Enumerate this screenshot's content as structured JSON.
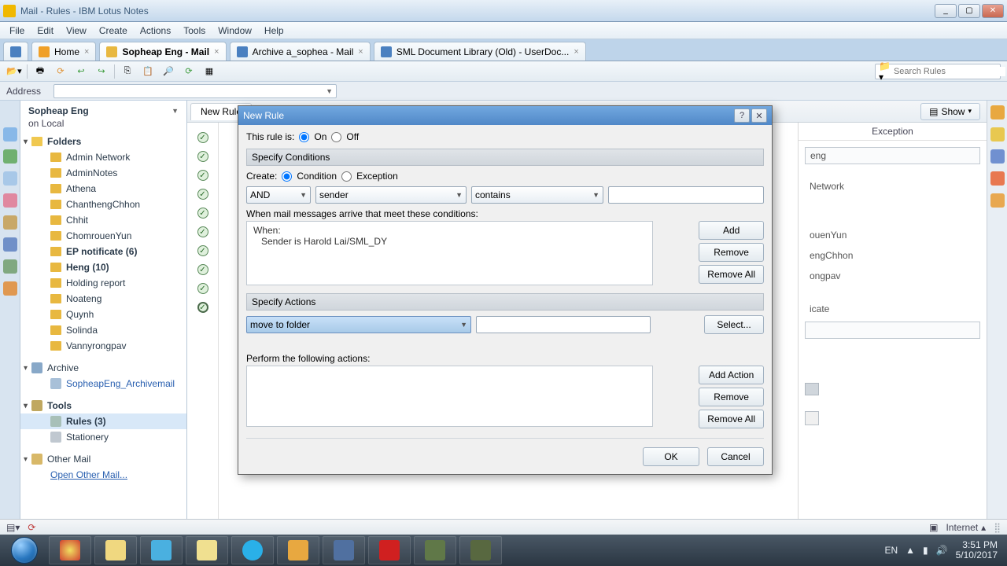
{
  "window": {
    "title": "Mail - Rules - IBM Lotus Notes"
  },
  "menu": {
    "file": "File",
    "edit": "Edit",
    "view": "View",
    "create": "Create",
    "actions": "Actions",
    "tools": "Tools",
    "window": "Window",
    "help": "Help"
  },
  "tabs": [
    {
      "label": "Home",
      "closable": true
    },
    {
      "label": "Sopheap Eng - Mail",
      "closable": true,
      "active": true
    },
    {
      "label": "Archive a_sophea - Mail",
      "closable": true
    },
    {
      "label": "SML Document Library (Old) - UserDoc...",
      "closable": true
    }
  ],
  "toolbar": {
    "search_placeholder": "Search Rules"
  },
  "addressbar": {
    "label": "Address"
  },
  "sidebar": {
    "account": "Sopheap Eng",
    "location": "on Local",
    "folders_label": "Folders",
    "folders": [
      "Admin Network",
      "AdminNotes",
      "Athena",
      "ChanthengChhon",
      "Chhit",
      "ChomrouenYun",
      "EP notificate (6)",
      "Heng (10)",
      "Holding report",
      "Noateng",
      "Quynh",
      "Solinda",
      "Vannyrongpav"
    ],
    "archive_label": "Archive",
    "archive_items": [
      "SopheapEng_Archivemail"
    ],
    "tools_label": "Tools",
    "tools_items": [
      "Rules (3)",
      "Stationery"
    ],
    "othermail_label": "Other Mail",
    "othermail_link": "Open Other Mail..."
  },
  "main": {
    "tab": "New Rule",
    "show_label": "Show",
    "exception_header": "Exception",
    "exception_items": [
      "eng",
      "Network",
      "ouenYun",
      "engChhon",
      "ongpav",
      "icate"
    ]
  },
  "dialog": {
    "title": "New Rule",
    "rule_is_label": "This rule is:",
    "on": "On",
    "off": "Off",
    "spec_cond": "Specify Conditions",
    "create_label": "Create:",
    "condition": "Condition",
    "exception": "Exception",
    "combo_and": "AND",
    "combo_field": "sender",
    "combo_op": "contains",
    "cond_input": "",
    "when_label": "When mail messages arrive that meet these conditions:",
    "when_header": "When:",
    "cond_line1": "Sender is Harold Lai/SML_DY",
    "spec_actions": "Specify Actions",
    "action_sel": "move to folder",
    "action_input": "",
    "perform_label": "Perform the following actions:",
    "btn_add": "Add",
    "btn_remove": "Remove",
    "btn_removeall": "Remove All",
    "btn_select": "Select...",
    "btn_addaction": "Add Action",
    "btn_ok": "OK",
    "btn_cancel": "Cancel"
  },
  "status": {
    "internet": "Internet"
  },
  "tray": {
    "lang": "EN",
    "time": "3:51 PM",
    "date": "5/10/2017"
  },
  "colors": {
    "tab1": "#e07a30",
    "tab2": "#f0c850",
    "tab3": "#3a80c0",
    "tab4": "#4aa8d0",
    "tab5": "#f09020",
    "ls1": "#f0b820",
    "ls2": "#88b8e8",
    "ls3": "#70b070",
    "ls4": "#a8c8e8",
    "ls5": "#e088a0",
    "ls6": "#c8a868",
    "ls7": "#7090c8",
    "ls8": "#80a880",
    "ls9": "#e09850",
    "rs1": "#e8a840",
    "rs2": "#e8c850",
    "rs3": "#7090d0",
    "rs4": "#e87850",
    "rs5": "#e8a850",
    "tb1": "#f0c060",
    "tb2": "#4a90d0",
    "tb3": "#4ab0e0",
    "tb4": "#f0c860",
    "tb5": "#e84020",
    "tb6": "#c4a060",
    "tb7": "#4a68a0",
    "tb8": "#d02020",
    "tb9": "#607040",
    "tb10": "#506040"
  }
}
